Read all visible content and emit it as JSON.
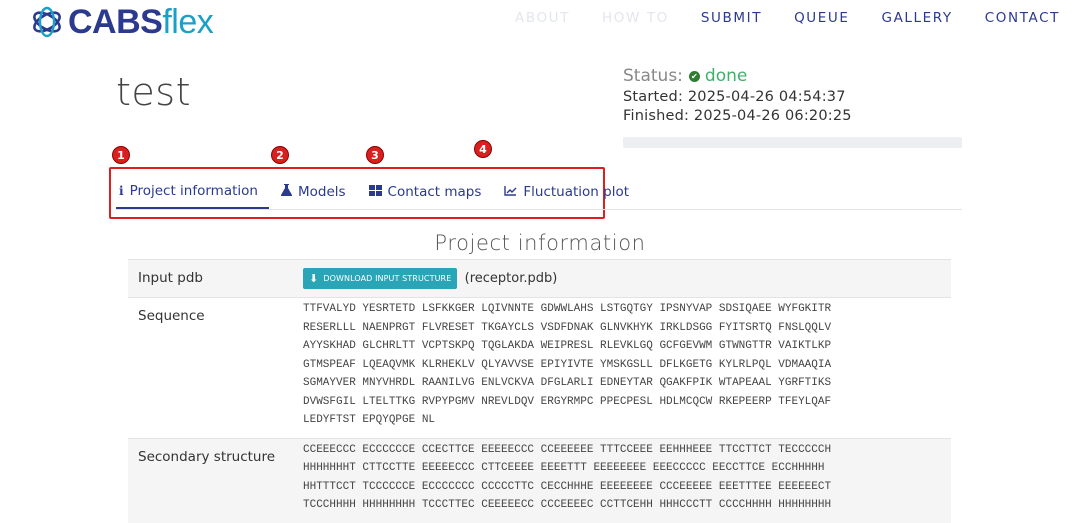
{
  "header": {
    "logo_cabs": "CABS",
    "logo_flex": "flex",
    "nav": [
      {
        "label": "ABOUT",
        "faded": true
      },
      {
        "label": "HOW TO",
        "faded": true
      },
      {
        "label": "SUBMIT",
        "faded": false
      },
      {
        "label": "QUEUE",
        "faded": false
      },
      {
        "label": "GALLERY",
        "faded": false
      },
      {
        "label": "CONTACT",
        "faded": false
      }
    ]
  },
  "project": {
    "title": "test",
    "status_label": "Status:",
    "status_value": "done",
    "started": "Started: 2025-04-26 04:54:37",
    "finished": "Finished: 2025-04-26 06:20:25"
  },
  "tabs": [
    {
      "label": "Project information",
      "icon": "i",
      "badge": "1"
    },
    {
      "label": "Models",
      "icon": "⚗",
      "badge": "2"
    },
    {
      "label": "Contact maps",
      "icon": "▦",
      "badge": "3"
    },
    {
      "label": "Fluctuation plot",
      "icon": "⟋",
      "badge": "4"
    }
  ],
  "section": {
    "title": "Project information",
    "rows": {
      "input_pdb_label": "Input pdb",
      "download_button": "DOWNLOAD INPUT STRUCTURE",
      "filename": "(receptor.pdb)",
      "sequence_label": "Sequence",
      "sequence": "TTFVALYD YESRTETD LSFKKGER LQIVNNTE GDWWLAHS LSTGQTGY IPSNYVAP SDSIQAEE WYFGKITR\nRESERLLL NAENPRGT FLVRESET TKGAYCLS VSDFDNAK GLNVKHYK IRKLDSGG FYITSRTQ FNSLQQLV\nAYYSKHAD GLCHRLTT VCPTSKPQ TQGLAKDA WEIPRESL RLEVKLGQ GCFGEVWM GTWNGTTR VAIKTLKP\nGTMSPEAF LQEAQVMK KLRHEKLV QLYAVVSE EPIYIVTE YMSKGSLL DFLKGETG KYLRLPQL VDMAAQIA\nSGMAYVER MNYVHRDL RAANILVG ENLVCKVA DFGLARLI EDNEYTAR QGAKFPIK WTAPEAAL YGRFTIKS\nDVWSFGIL LTELTTKG RVPYPGMV NREVLDQV ERGYRMPC PPECPESL HDLMCQCW RKEPEERP TFEYLQAF\nLEDYFTST EPQYQPGE NL",
      "secondary_label": "Secondary structure",
      "secondary": "CCEEECCC ECCCCCCE CCECTTCE EEEEECCC CCEEEEEE TTTCCEEE EEHHHEEE TTCCTTCT TECCCCCH\nHHHHHHHT CTTCCTTE EEEEECCC CTTCEEEE EEEETTT EEEEEEEE EEECCCCC EECCTTCE ECCHHHHH\nHHTTTCCT TCCCCCCE ECCCCCCC CCCCCTTC CECCHHHE EEEEEEEE CCCEEEEE EEETTTEE EEEEEECT\nTCCCHHHH HHHHHHHH TCCCTTEC CEEEEECC CCCEEEEC CCTTCEHH HHHCCCTT CCCCHHHH HHHHHHHH"
    }
  },
  "colors": {
    "brand_navy": "#2b3a8f",
    "brand_cyan": "#1aa0c8",
    "status_green": "#3eb06a",
    "highlight_red": "#e01e1e",
    "button_teal": "#2aa5b8"
  }
}
